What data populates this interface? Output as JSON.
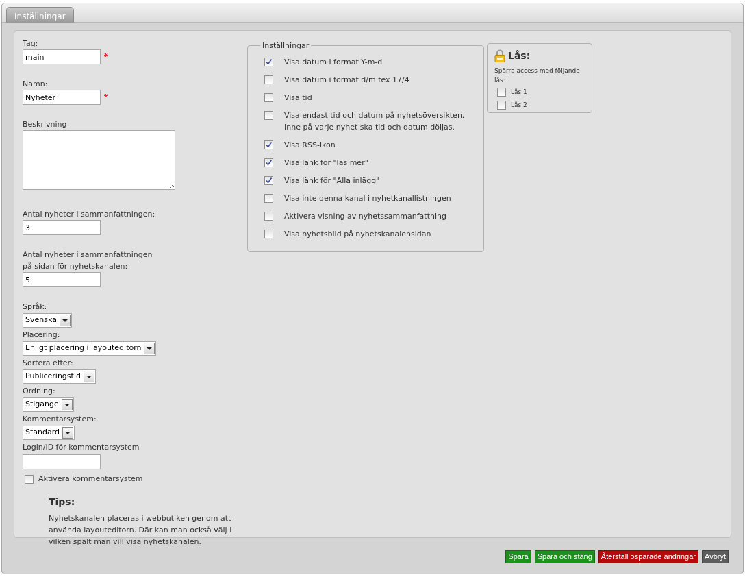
{
  "tabs": [
    {
      "label": "Inställningar",
      "selected": true
    }
  ],
  "fields": [
    {
      "kind": "text",
      "label": "Tag:",
      "value": "main",
      "required": true
    },
    {
      "kind": "text",
      "label": "Namn:",
      "value": "Nyheter",
      "required": true
    },
    {
      "kind": "textarea",
      "label": "Beskrivning",
      "required": false
    },
    {
      "kind": "text",
      "label": "Antal nyheter i sammanfattningen:",
      "value": "3",
      "required": false
    },
    {
      "kind": "text",
      "label": "Antal nyheter i sammanfattningen\npå sidan för nyhetskanalen:",
      "value": "5",
      "required": false
    }
  ],
  "dropdowns": [
    {
      "label": "Språk:",
      "value": "Svenska"
    },
    {
      "label": "Placering:",
      "value": "Enligt placering i layouteditorn"
    },
    {
      "label": "Sortera efter:",
      "value": "Publiceringstid"
    },
    {
      "label": "Ordning:",
      "value": "Stigange"
    },
    {
      "label": "Kommentarsystem:",
      "value": "Standard"
    }
  ],
  "login": {
    "label": "Login/ID för kommentarsystem"
  },
  "comment_checkbox": {
    "label": "Aktivera kommentarsystem",
    "checked": false
  },
  "tips": {
    "title": "Tips:",
    "text": "Nyhetskanalen placeras i webbutiken genom att\nanvända layouteditorn. Där kan man också välj i\nvilken spalt man vill visa nyhetskanalen."
  },
  "settings": {
    "legend": "Inställningar",
    "options": [
      {
        "label": "Visa datum i format Y-m-d",
        "checked": true
      },
      {
        "label": "Visa datum i format d/m tex 17/4",
        "checked": false
      },
      {
        "label": "Visa tid",
        "checked": false
      },
      {
        "label": "Visa endast tid och datum på nyhetsöversikten.\nInne på varje nyhet ska tid och datum döljas.",
        "checked": false
      },
      {
        "label": "Visa RSS-ikon",
        "checked": true
      },
      {
        "label": "Visa länk för \"läs mer\"",
        "checked": true
      },
      {
        "label": "Visa länk för \"Alla inlägg\"",
        "checked": true
      },
      {
        "label": "Visa inte denna kanal i nyhetkanallistningen",
        "checked": false
      },
      {
        "label": "Aktivera visning av nyhetssammanfattning",
        "checked": false
      },
      {
        "label": "Visa nyhetsbild på nyhetskanalensidan",
        "checked": false
      }
    ]
  },
  "lock": {
    "title": "Lås:",
    "subtitle": "Spärra access med följande lås:",
    "locks": [
      {
        "label": "Lås 1",
        "checked": false
      },
      {
        "label": "Lås 2",
        "checked": false
      }
    ]
  },
  "buttons": [
    {
      "label": "Spara",
      "color": "#1f8f1f"
    },
    {
      "label": "Spara och stäng",
      "color": "#1f8f1f"
    },
    {
      "label": "Återställ osparade ändringar",
      "color": "#b80a0a"
    },
    {
      "label": "Avbryt",
      "color": "#5c5c5c"
    }
  ]
}
